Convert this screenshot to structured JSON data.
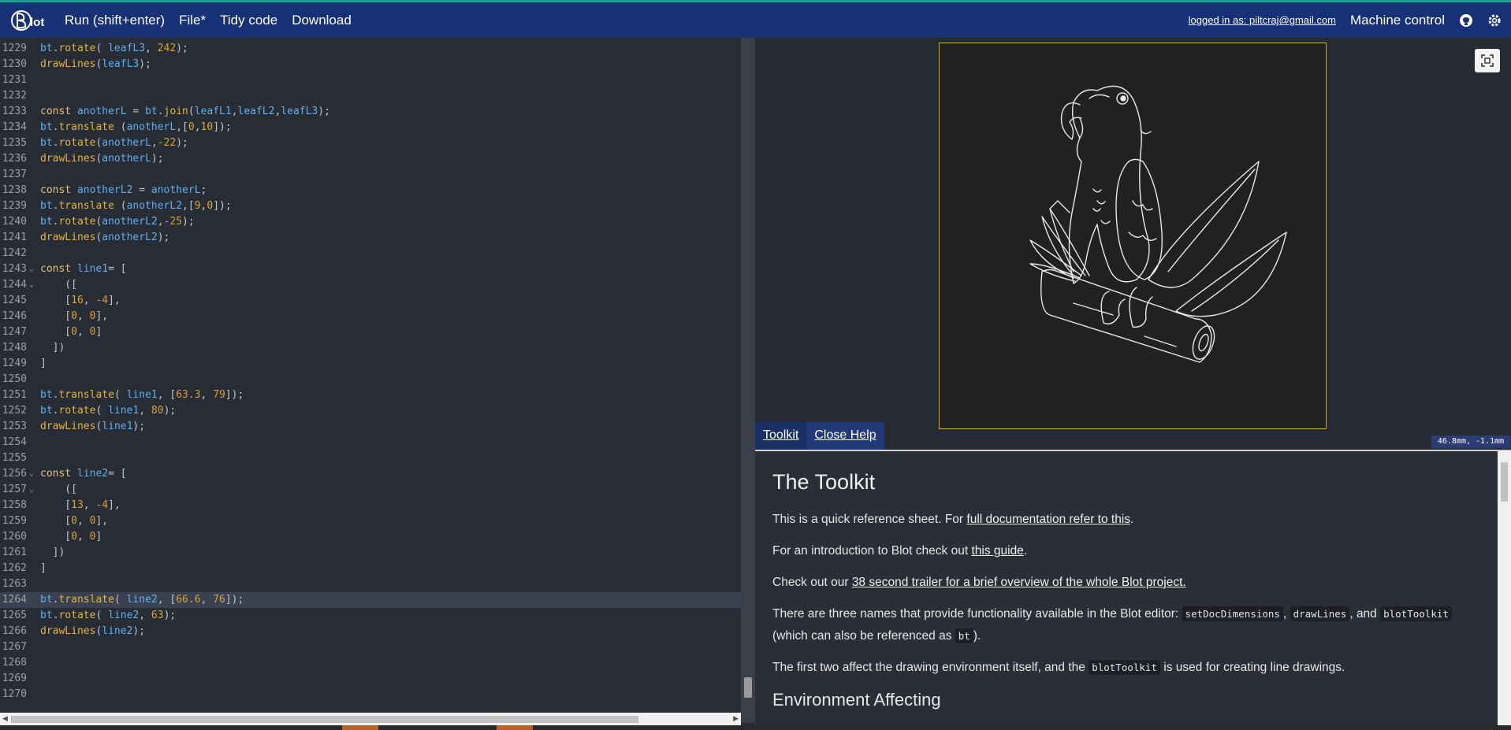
{
  "topbar": {
    "menu": [
      "Run (shift+enter)",
      "File*",
      "Tidy code",
      "Download"
    ],
    "login": "logged in as: piltcraj@gmail.com",
    "machine_control": "Machine control"
  },
  "editor": {
    "lines": [
      {
        "n": "1229",
        "fold": "",
        "code": "bt.rotate( leafL3, 242);"
      },
      {
        "n": "1230",
        "fold": "",
        "code": "drawLines(leafL3);"
      },
      {
        "n": "1231",
        "fold": "",
        "code": ""
      },
      {
        "n": "1232",
        "fold": "",
        "code": ""
      },
      {
        "n": "1233",
        "fold": "",
        "code": "const anotherL = bt.join(leafL1,leafL2,leafL3);"
      },
      {
        "n": "1234",
        "fold": "",
        "code": "bt.translate (anotherL,[0,10]);"
      },
      {
        "n": "1235",
        "fold": "",
        "code": "bt.rotate(anotherL,-22);"
      },
      {
        "n": "1236",
        "fold": "",
        "code": "drawLines(anotherL);"
      },
      {
        "n": "1237",
        "fold": "",
        "code": ""
      },
      {
        "n": "1238",
        "fold": "",
        "code": "const anotherL2 = anotherL;"
      },
      {
        "n": "1239",
        "fold": "",
        "code": "bt.translate (anotherL2,[9,0]);"
      },
      {
        "n": "1240",
        "fold": "",
        "code": "bt.rotate(anotherL2,-25);"
      },
      {
        "n": "1241",
        "fold": "",
        "code": "drawLines(anotherL2);"
      },
      {
        "n": "1242",
        "fold": "",
        "code": ""
      },
      {
        "n": "1243",
        "fold": "⌄",
        "code": "const line1= ["
      },
      {
        "n": "1244",
        "fold": "⌄",
        "code": "    ([  "
      },
      {
        "n": "1245",
        "fold": "",
        "code": "    [16, -4],"
      },
      {
        "n": "1246",
        "fold": "",
        "code": "    [0, 0],"
      },
      {
        "n": "1247",
        "fold": "",
        "code": "    [0, 0]"
      },
      {
        "n": "1248",
        "fold": "",
        "code": "  ])"
      },
      {
        "n": "1249",
        "fold": "",
        "code": "]"
      },
      {
        "n": "1250",
        "fold": "",
        "code": ""
      },
      {
        "n": "1251",
        "fold": "",
        "code": "bt.translate( line1, [63.3, 79]);"
      },
      {
        "n": "1252",
        "fold": "",
        "code": "bt.rotate( line1, 80);"
      },
      {
        "n": "1253",
        "fold": "",
        "code": "drawLines(line1);"
      },
      {
        "n": "1254",
        "fold": "",
        "code": ""
      },
      {
        "n": "1255",
        "fold": "",
        "code": ""
      },
      {
        "n": "1256",
        "fold": "⌄",
        "code": "const line2= ["
      },
      {
        "n": "1257",
        "fold": "⌄",
        "code": "    ([  "
      },
      {
        "n": "1258",
        "fold": "",
        "code": "    [13, -4],"
      },
      {
        "n": "1259",
        "fold": "",
        "code": "    [0, 0],"
      },
      {
        "n": "1260",
        "fold": "",
        "code": "    [0, 0]"
      },
      {
        "n": "1261",
        "fold": "",
        "code": "  ])"
      },
      {
        "n": "1262",
        "fold": "",
        "code": "]"
      },
      {
        "n": "1263",
        "fold": "",
        "code": ""
      },
      {
        "n": "1264",
        "fold": "",
        "code": "bt.translate( line2, [66.6, 76]);",
        "highlight": true
      },
      {
        "n": "1265",
        "fold": "",
        "code": "bt.rotate( line2, 63);"
      },
      {
        "n": "1266",
        "fold": "",
        "code": "drawLines(line2);"
      },
      {
        "n": "1267",
        "fold": "",
        "code": ""
      },
      {
        "n": "1268",
        "fold": "",
        "code": ""
      },
      {
        "n": "1269",
        "fold": "",
        "code": ""
      },
      {
        "n": "1270",
        "fold": "",
        "code": ""
      }
    ]
  },
  "preview": {
    "coords": "46.8mm, -1.1mm",
    "tabs": [
      "Toolkit",
      "Close Help"
    ]
  },
  "help": {
    "title": "The Toolkit",
    "p1_pre": "This is a quick reference sheet. For ",
    "p1_link": "full documentation refer to this",
    "p1_post": ".",
    "p2_pre": "For an introduction to Blot check out ",
    "p2_link": "this guide",
    "p2_post": ".",
    "p3_pre": "Check out our ",
    "p3_link": "38 second trailer for a brief overview of the whole Blot project.",
    "p4_pre": "There are three names that provide functionality available in the Blot editor: ",
    "p4_code1": "setDocDimensions",
    "p4_sep1": ", ",
    "p4_code2": "drawLines",
    "p4_sep2": ", and ",
    "p4_code3": "blotToolkit",
    "p4_mid": " (which can also be referenced as ",
    "p4_code4": "bt",
    "p4_post": ").",
    "p5_pre": "The first two affect the drawing environment itself, and the ",
    "p5_code": "blotToolkit",
    "p5_post": " is used for creating line drawings.",
    "h2": "Environment Affecting"
  }
}
